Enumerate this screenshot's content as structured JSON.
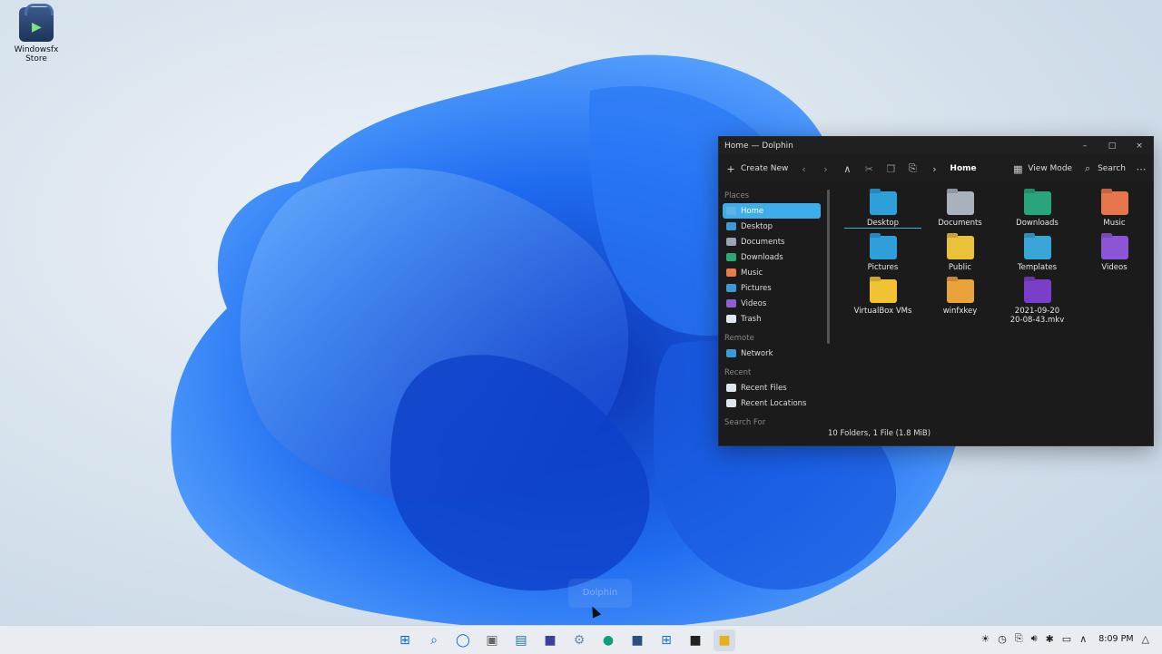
{
  "desktop": {
    "icon_label": "Windowsfx Store"
  },
  "window": {
    "title": "Home — Dolphin",
    "controls": {
      "minimize": "–",
      "maximize": "□",
      "close": "×"
    },
    "toolbar": {
      "create_new": "Create New",
      "breadcrumb": "Home",
      "view_mode": "View Mode",
      "search": "Search"
    },
    "sidebar": {
      "places_header": "Places",
      "places": [
        {
          "label": "Home",
          "color": "#5fb3e6"
        },
        {
          "label": "Desktop",
          "color": "#3b9bd6"
        },
        {
          "label": "Documents",
          "color": "#9aa4b1"
        },
        {
          "label": "Downloads",
          "color": "#2ea67a"
        },
        {
          "label": "Music",
          "color": "#e97c4a"
        },
        {
          "label": "Pictures",
          "color": "#3b9bd6"
        },
        {
          "label": "Videos",
          "color": "#8d5fd3"
        },
        {
          "label": "Trash",
          "color": "#dfe6ee"
        }
      ],
      "remote_header": "Remote",
      "remote": [
        {
          "label": "Network",
          "color": "#3b9bd6"
        }
      ],
      "recent_header": "Recent",
      "recent": [
        {
          "label": "Recent Files",
          "color": "#dfe6ee"
        },
        {
          "label": "Recent Locations",
          "color": "#dfe6ee"
        }
      ],
      "search_header": "Search For"
    },
    "files": [
      {
        "label": "Desktop",
        "color": "#2f9fd9"
      },
      {
        "label": "Documents",
        "color": "#a9b1bc"
      },
      {
        "label": "Downloads",
        "color": "#28a57c"
      },
      {
        "label": "Music",
        "color": "#e8764c"
      },
      {
        "label": "Pictures",
        "color": "#2f9fd9"
      },
      {
        "label": "Public",
        "color": "#e9c23a"
      },
      {
        "label": "Templates",
        "color": "#3aa6d8"
      },
      {
        "label": "Videos",
        "color": "#8b55d6"
      },
      {
        "label": "VirtualBox VMs",
        "color": "#f1c232"
      },
      {
        "label": "winfxkey",
        "color": "#e9a33a"
      },
      {
        "label": "2021-09-20 20-08-43.mkv",
        "color": "#7a3fc9"
      }
    ],
    "status": "10 Folders, 1 File (1.8 MiB)"
  },
  "taskbar": {
    "ghost_label": "Dolphin",
    "time": "8:09 PM"
  }
}
